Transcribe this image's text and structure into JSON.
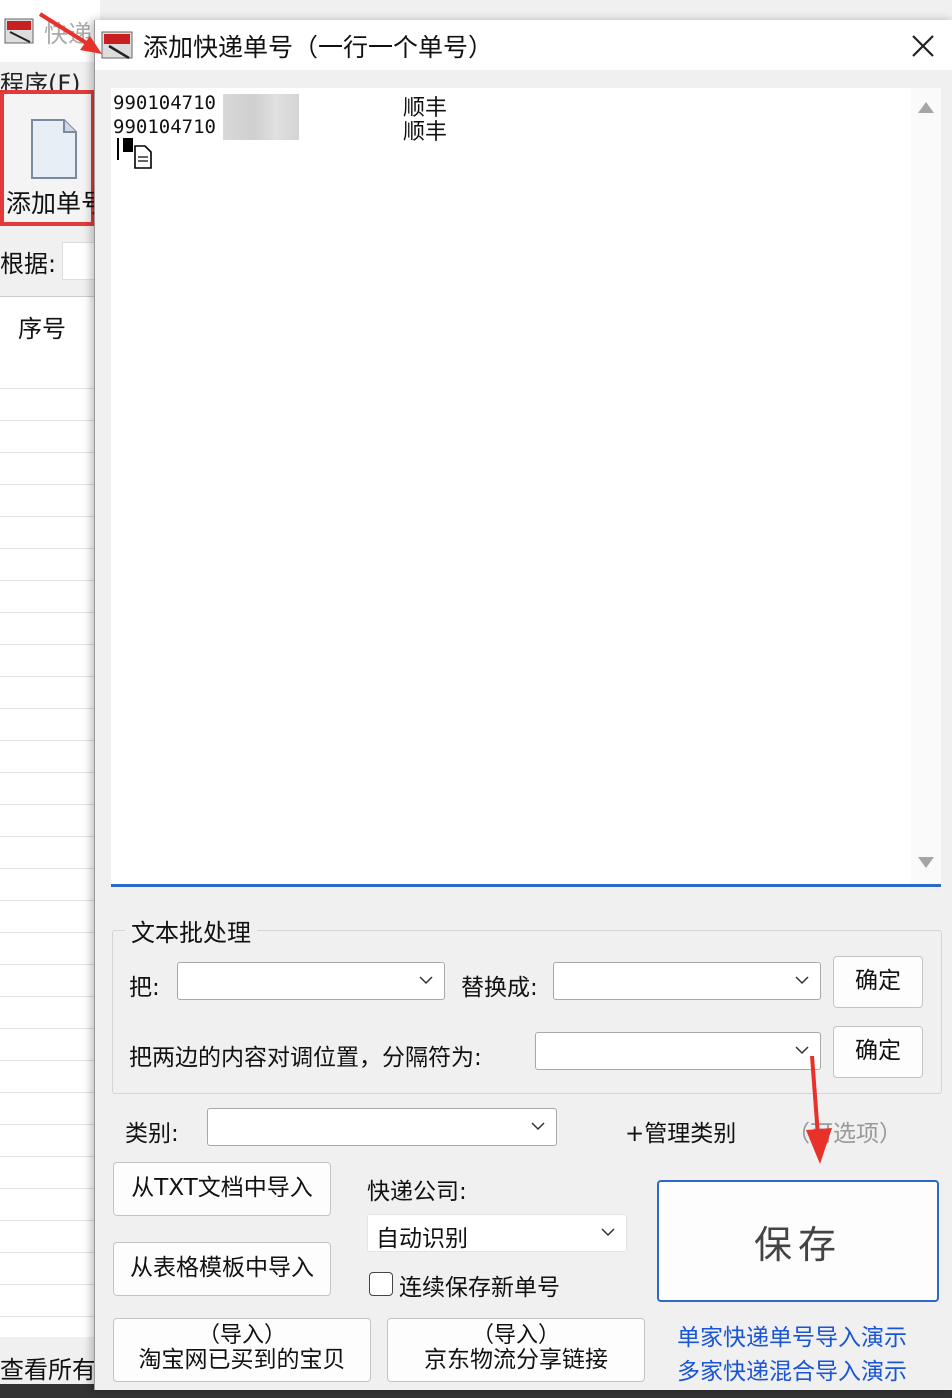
{
  "background_window": {
    "title": "快递",
    "menu": "程序(F)",
    "add_button_label": "添加单号",
    "basis_label": "根据:",
    "grid_header": "序号",
    "view_all": "查看所有"
  },
  "dialog": {
    "title": "添加快递单号（一行一个单号）",
    "lines": [
      {
        "number": "990104710",
        "carrier": "顺丰"
      },
      {
        "number": "990104710",
        "carrier": "顺丰"
      }
    ],
    "batch": {
      "group_title": "文本批处理",
      "replace_from_label": "把:",
      "replace_to_label": "替换成:",
      "confirm_label": "确定",
      "swap_label": "把两边的内容对调位置，分隔符为:",
      "confirm2_label": "确定"
    },
    "category_label": "类别:",
    "manage_category": "+管理类别",
    "optional_hint": "（可选项）",
    "import_txt": "从TXT文档中导入",
    "import_template": "从表格模板中导入",
    "courier_label": "快递公司:",
    "courier_value": "自动识别",
    "continuous_save": "连续保存新单号",
    "save_label": "保存",
    "taobao_import_top": "（导入）",
    "taobao_import_bottom": "淘宝网已买到的宝贝",
    "jd_import_top": "（导入）",
    "jd_import_bottom": "京东物流分享链接",
    "demo_single": "单家快递单号导入演示",
    "demo_multi": "多家快递混合导入演示"
  },
  "colors": {
    "highlight_red": "#e23a3a",
    "focus_blue": "#2a6bc5",
    "link_blue": "#1a55d6"
  },
  "icons": [
    "app-icon",
    "document-icon",
    "close-icon",
    "chevron-down-icon",
    "scroll-up-icon",
    "scroll-down-icon",
    "cursor-copy-icon"
  ]
}
